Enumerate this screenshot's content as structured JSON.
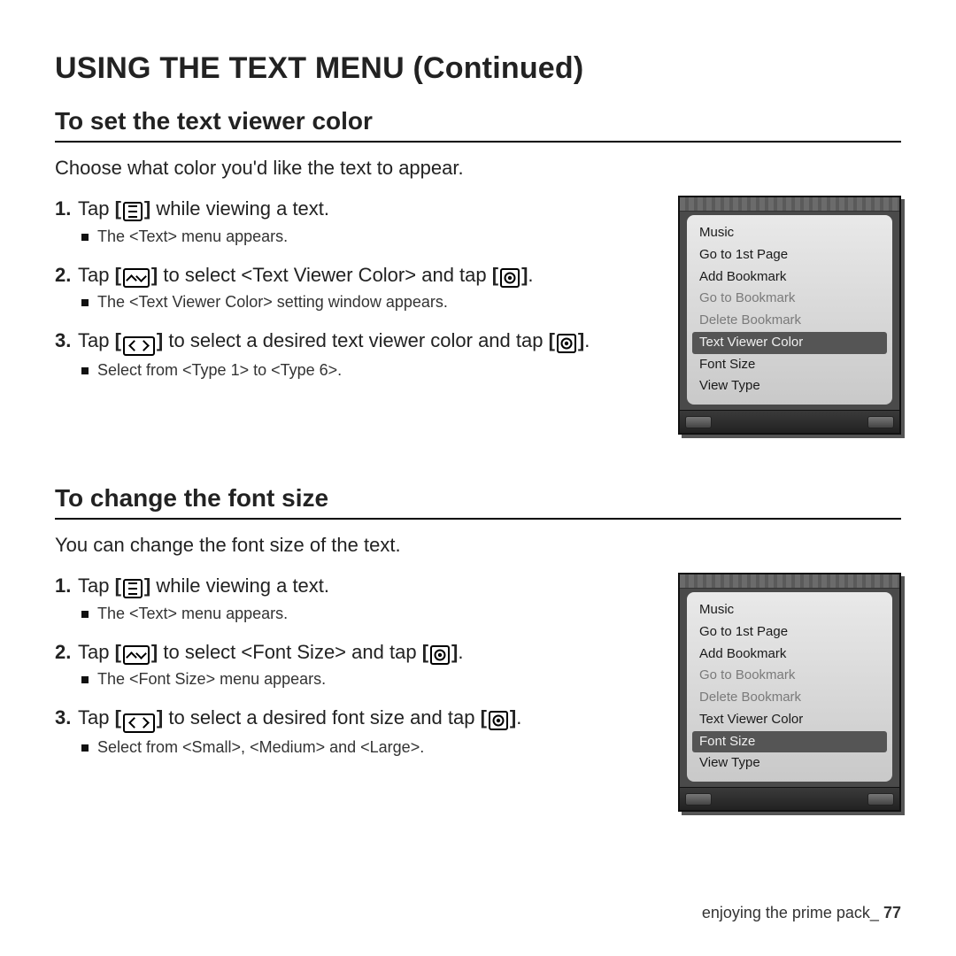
{
  "page_title": "USING THE TEXT MENU (Continued)",
  "footer": {
    "label": "enjoying the prime pack_",
    "page": "77"
  },
  "menu_items": [
    {
      "label": "Music",
      "dim": false
    },
    {
      "label": "Go to 1st Page",
      "dim": false
    },
    {
      "label": "Add Bookmark",
      "dim": false
    },
    {
      "label": "Go to Bookmark",
      "dim": true
    },
    {
      "label": "Delete Bookmark",
      "dim": true
    },
    {
      "label": "Text Viewer Color",
      "dim": false
    },
    {
      "label": "Font Size",
      "dim": false
    },
    {
      "label": "View Type",
      "dim": false
    }
  ],
  "section1": {
    "heading": "To set the text viewer color",
    "intro": "Choose what color you'd like the text to appear.",
    "selected_index": 5,
    "step1_a": "Tap ",
    "step1_b": " while viewing a text.",
    "step1_sub": "The <Text> menu appears.",
    "step2_a": "Tap ",
    "step2_b": " to select ",
    "step2_bold": "<Text Viewer Color>",
    "step2_c": " and tap ",
    "step2_d": ".",
    "step2_sub": "The <Text Viewer Color> setting window appears.",
    "step3_a": "Tap ",
    "step3_b": " to select a desired text viewer color and tap ",
    "step3_c": ".",
    "step3_sub": "Select from <Type 1> to <Type 6>."
  },
  "section2": {
    "heading": "To change the font size",
    "intro": "You can change the font size of the text.",
    "selected_index": 6,
    "step1_a": "Tap ",
    "step1_b": " while viewing a text.",
    "step1_sub": "The <Text> menu appears.",
    "step2_a": "Tap ",
    "step2_b": " to select ",
    "step2_bold": "<Font Size>",
    "step2_c": " and tap ",
    "step2_d": ".",
    "step2_sub": "The <Font Size> menu appears.",
    "step3_a": "Tap ",
    "step3_b": " to select a desired font size and tap ",
    "step3_c": ".",
    "step3_sub": "Select from <Small>, <Medium> and <Large>."
  }
}
